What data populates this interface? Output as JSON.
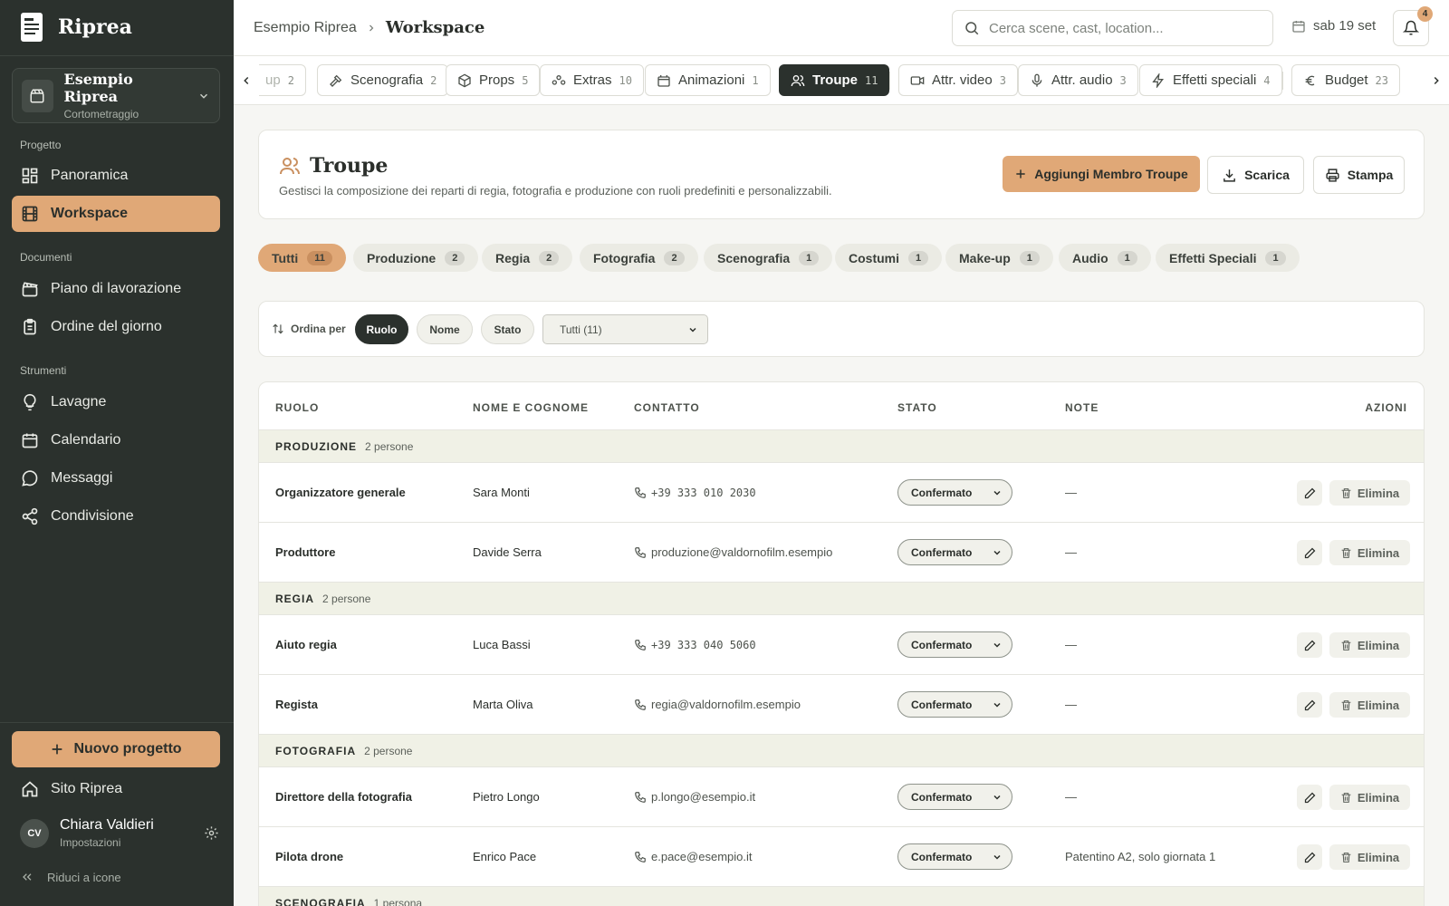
{
  "app": {
    "name": "Riprea"
  },
  "project": {
    "name": "Esempio Riprea",
    "type": "Cortometraggio"
  },
  "sidebar": {
    "sections": [
      {
        "label": "Progetto",
        "items": [
          {
            "label": "Panoramica",
            "icon": "dashboard-icon"
          },
          {
            "label": "Workspace",
            "icon": "film-icon",
            "active": true
          }
        ]
      },
      {
        "label": "Documenti",
        "items": [
          {
            "label": "Piano di lavorazione",
            "icon": "clapper-icon"
          },
          {
            "label": "Ordine del giorno",
            "icon": "clipboard-icon"
          }
        ]
      },
      {
        "label": "Strumenti",
        "items": [
          {
            "label": "Lavagne",
            "icon": "lightbulb-icon"
          },
          {
            "label": "Calendario",
            "icon": "calendar-icon"
          },
          {
            "label": "Messaggi",
            "icon": "chat-icon"
          },
          {
            "label": "Condivisione",
            "icon": "share-icon"
          }
        ]
      }
    ],
    "new_project": "Nuovo progetto",
    "site_link": "Sito Riprea",
    "user": {
      "initials": "CV",
      "name": "Chiara Valdieri",
      "sub": "Impostazioni"
    },
    "collapse": "Riduci a icone"
  },
  "topbar": {
    "breadcrumb": [
      "Esempio Riprea",
      "Workspace"
    ],
    "search_placeholder": "Cerca scene, cast, location...",
    "date": "sab 19 set",
    "notifications": "4"
  },
  "tabs": [
    {
      "label": "up",
      "count": "2",
      "icon": "brush-icon"
    },
    {
      "label": "Scenografia",
      "count": "2",
      "icon": "hammer-icon"
    },
    {
      "label": "Props",
      "count": "5",
      "icon": "box-icon"
    },
    {
      "label": "Extras",
      "count": "10",
      "icon": "group-icon"
    },
    {
      "label": "Animazioni",
      "count": "1",
      "icon": "paw-icon"
    },
    {
      "label": "Troupe",
      "count": "11",
      "icon": "users-icon",
      "active": true
    },
    {
      "label": "Attr. video",
      "count": "3",
      "icon": "video-icon"
    },
    {
      "label": "Attr. audio",
      "count": "3",
      "icon": "mic-icon"
    },
    {
      "label": "Effetti speciali",
      "count": "4",
      "icon": "zap-icon"
    },
    {
      "label": "Budget",
      "count": "23",
      "icon": "euro-icon"
    }
  ],
  "header": {
    "title": "Troupe",
    "description": "Gestisci la composizione dei reparti di regia, fotografia e produzione con ruoli predefiniti e personalizzabili.",
    "add_button": "Aggiungi Membro Troupe",
    "download_button": "Scarica",
    "print_button": "Stampa"
  },
  "filters": [
    {
      "label": "Tutti",
      "count": "11",
      "active": true
    },
    {
      "label": "Produzione",
      "count": "2"
    },
    {
      "label": "Regia",
      "count": "2"
    },
    {
      "label": "Fotografia",
      "count": "2"
    },
    {
      "label": "Scenografia",
      "count": "1"
    },
    {
      "label": "Costumi",
      "count": "1"
    },
    {
      "label": "Make-up",
      "count": "1"
    },
    {
      "label": "Audio",
      "count": "1"
    },
    {
      "label": "Effetti Speciali",
      "count": "1"
    }
  ],
  "sort": {
    "label": "Ordina per",
    "options": [
      "Ruolo",
      "Nome",
      "Stato"
    ],
    "active": "Ruolo",
    "select_value": "Tutti (11)"
  },
  "table": {
    "columns": [
      "RUOLO",
      "NOME E COGNOME",
      "CONTATTO",
      "STATO",
      "NOTE",
      "AZIONI"
    ],
    "edit_icon": "pencil-icon",
    "delete_label": "Elimina",
    "groups": [
      {
        "name": "PRODUZIONE",
        "count": "2 persone",
        "rows": [
          {
            "role": "Organizzatore generale",
            "name": "Sara Monti",
            "contact": "+39 333 010 2030",
            "contact_type": "phone",
            "status": "Confermato",
            "note": "—"
          },
          {
            "role": "Produttore",
            "name": "Davide Serra",
            "contact": "produzione@valdornofilm.esempio",
            "contact_type": "email",
            "status": "Confermato",
            "note": "—"
          }
        ]
      },
      {
        "name": "REGIA",
        "count": "2 persone",
        "rows": [
          {
            "role": "Aiuto regia",
            "name": "Luca Bassi",
            "contact": "+39 333 040 5060",
            "contact_type": "phone",
            "status": "Confermato",
            "note": "—"
          },
          {
            "role": "Regista",
            "name": "Marta Oliva",
            "contact": "regia@valdornofilm.esempio",
            "contact_type": "email",
            "status": "Confermato",
            "note": "—"
          }
        ]
      },
      {
        "name": "FOTOGRAFIA",
        "count": "2 persone",
        "rows": [
          {
            "role": "Direttore della fotografia",
            "name": "Pietro Longo",
            "contact": "p.longo@esempio.it",
            "contact_type": "email",
            "status": "Confermato",
            "note": "—"
          },
          {
            "role": "Pilota drone",
            "name": "Enrico Pace",
            "contact": "e.pace@esempio.it",
            "contact_type": "email",
            "status": "Confermato",
            "note": "Patentino A2, solo giornata 1"
          }
        ]
      },
      {
        "name": "SCENOGRAFIA",
        "count": "1 persona",
        "rows": []
      }
    ]
  },
  "colors": {
    "sidebar_bg": "#2b312d",
    "accent": "#e0a877",
    "group_bg": "#f0f1e6"
  }
}
